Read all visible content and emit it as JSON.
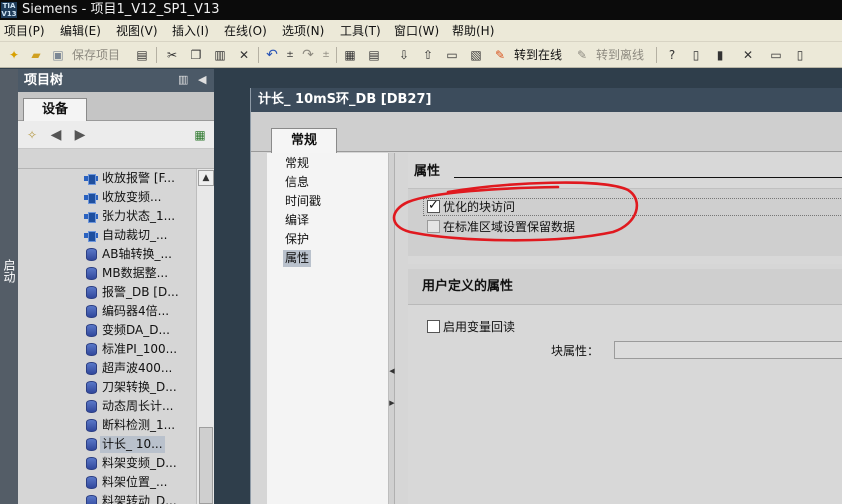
{
  "window": {
    "logo_text": "TIA\nV13",
    "title": "Siemens  -  项目1_V12_SP1_V13"
  },
  "menu": {
    "items": [
      "项目(P)",
      "编辑(E)",
      "视图(V)",
      "插入(I)",
      "在线(O)",
      "选项(N)",
      "工具(T)",
      "窗口(W)",
      "帮助(H)"
    ]
  },
  "toolbar": {
    "save_project_label": "保存项目",
    "go_online_label": "转到在线",
    "go_offline_label": "转到离线"
  },
  "left_strip": {
    "label": "启动"
  },
  "project_tree": {
    "title": "项目树",
    "devices_tab": "设备",
    "items": [
      {
        "icon": "fb",
        "label": "收放报警 [F..."
      },
      {
        "icon": "fb",
        "label": "收放变频..."
      },
      {
        "icon": "fb",
        "label": "张力状态_1..."
      },
      {
        "icon": "fb",
        "label": "自动裁切_..."
      },
      {
        "icon": "db",
        "label": "AB轴转换_..."
      },
      {
        "icon": "db",
        "label": "MB数据整..."
      },
      {
        "icon": "db",
        "label": "报警_DB [D..."
      },
      {
        "icon": "db",
        "label": "编码器4倍..."
      },
      {
        "icon": "db",
        "label": "变频DA_D..."
      },
      {
        "icon": "db",
        "label": "标准PI_100..."
      },
      {
        "icon": "db",
        "label": "超声波400..."
      },
      {
        "icon": "db",
        "label": "刀架转换_D..."
      },
      {
        "icon": "db",
        "label": "动态周长计..."
      },
      {
        "icon": "db",
        "label": "断料检测_1..."
      },
      {
        "icon": "db",
        "label": "计长_ 10...",
        "selected": true
      },
      {
        "icon": "db",
        "label": "料架变频_D..."
      },
      {
        "icon": "db",
        "label": "料架位置_..."
      },
      {
        "icon": "db",
        "label": "料架转动_D..."
      }
    ]
  },
  "dialog": {
    "title": "计长_ 10mS环_DB [DB27]",
    "tab_general": "常规",
    "nav": [
      {
        "label": "常规"
      },
      {
        "label": "信息"
      },
      {
        "label": "时间戳"
      },
      {
        "label": "编译"
      },
      {
        "label": "保护"
      },
      {
        "label": "属性",
        "active": true
      }
    ],
    "attributes": {
      "title": "属性",
      "optimized_access": {
        "label": "优化的块访问",
        "checked": true
      },
      "retain_in_standard_area": {
        "label": "在标准区域设置保留数据",
        "checked": false,
        "enabled": false
      }
    },
    "user_attributes": {
      "title": "用户定义的属性",
      "enable_tag_readback": {
        "label": "启用变量回读",
        "checked": false
      },
      "block_attributes_label": "块属性：",
      "block_attributes_value": ""
    }
  },
  "colors": {
    "annotation": "#e0191f",
    "title_bar": "#0b0b0b",
    "panel_header": "#4b5967"
  }
}
